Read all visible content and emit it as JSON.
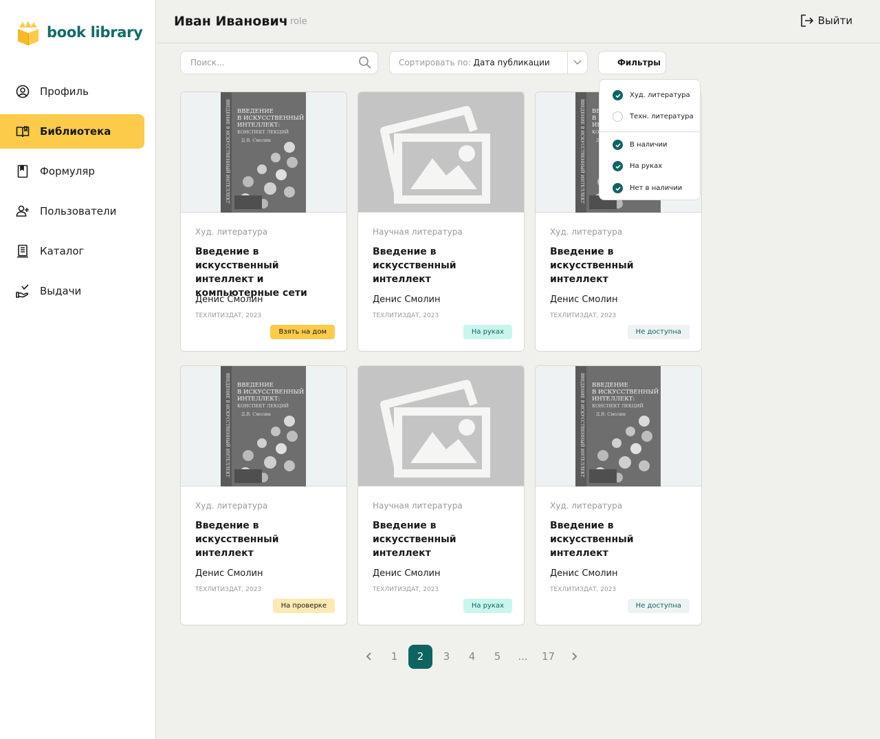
{
  "app": {
    "name": "book library",
    "brand_color": "#106b68",
    "accent": "#fdcb4a"
  },
  "sidebar": {
    "items": [
      {
        "label": "Профиль",
        "icon": "user-circle-icon"
      },
      {
        "label": "Библиотека",
        "icon": "open-book-icon",
        "active": true
      },
      {
        "label": "Формуляр",
        "icon": "bookmark-book-icon"
      },
      {
        "label": "Пользователи",
        "icon": "user-add-icon"
      },
      {
        "label": "Каталог",
        "icon": "catalog-icon"
      },
      {
        "label": "Выдачи",
        "icon": "hand-give-icon"
      }
    ]
  },
  "header": {
    "user_name": "Иван Иванович",
    "role": "role",
    "logout_label": "Выйти"
  },
  "toolbar": {
    "search_placeholder": "Поиск...",
    "sort_label": "Сортировать по:",
    "sort_value": "Дата публикации",
    "filters_label": "Фильтры"
  },
  "filters": {
    "options": [
      {
        "label": "Худ. литература",
        "checked": true
      },
      {
        "label": "Техн. литература",
        "checked": false
      },
      {
        "label": "В наличии",
        "checked": true
      },
      {
        "label": "На руках",
        "checked": true
      },
      {
        "label": "Нет в наличии",
        "checked": true
      }
    ]
  },
  "books": [
    {
      "genre": "Худ. литература",
      "title": "Введение в искусственный интеллект и компьютерные сети",
      "author": "Денис Смолин",
      "publisher": "ТЕХЛИТИЗДАТ, 2023",
      "status": "Взять на дом",
      "status_type": "take",
      "cover": "book"
    },
    {
      "genre": "Научная литература",
      "title": "Введение в искусственный интеллект",
      "author": "Денис Смолин",
      "publisher": "ТЕХЛИТИЗДАТ, 2023",
      "status": "На руках",
      "status_type": "hands",
      "cover": "placeholder"
    },
    {
      "genre": "Худ. литература",
      "title": "Введение в искусственный интеллект",
      "author": "Денис Смолин",
      "publisher": "ТЕХЛИТИЗДАТ, 2023",
      "status": "Не доступна",
      "status_type": "na",
      "cover": "book"
    },
    {
      "genre": "Худ. литература",
      "title": "Введение в искусственный интеллект",
      "author": "Денис Смолин",
      "publisher": "ТЕХЛИТИЗДАТ, 2023",
      "status": "На проверке",
      "status_type": "check",
      "cover": "book"
    },
    {
      "genre": "Научная литература",
      "title": "Введение в искусственный интеллект",
      "author": "Денис Смолин",
      "publisher": "ТЕХЛИТИЗДАТ, 2023",
      "status": "На руках",
      "status_type": "hands",
      "cover": "placeholder"
    },
    {
      "genre": "Худ. литература",
      "title": "Введение в искусственный интеллект",
      "author": "Денис Смолин",
      "publisher": "ТЕХЛИТИЗДАТ, 2023",
      "status": "Не доступна",
      "status_type": "na",
      "cover": "book"
    }
  ],
  "book_cover_text": {
    "lines": [
      "ВВЕДЕНИЕ",
      "В ИСКУССТВЕННЫЙ",
      "ИНТЕЛЛЕКТ:",
      "КОНСПЕКТ ЛЕКЦИЙ"
    ],
    "author": "Д.В. Смолин",
    "spine": "ВВЕДЕНИЕ В ИСКУССТВЕННЫЙ ИНТЕЛЛЕКТ"
  },
  "pagination": {
    "pages": [
      "1",
      "2",
      "3",
      "4",
      "5",
      "...",
      "17"
    ],
    "current": "2"
  }
}
